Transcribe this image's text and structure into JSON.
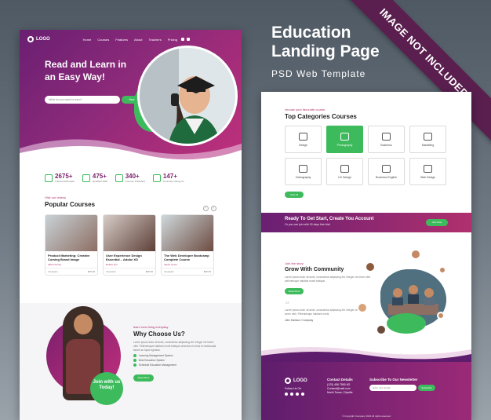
{
  "ribbon": "IMAGE NOT INCLUDED",
  "title": {
    "line1": "Education",
    "line2": "Landing Page",
    "subtitle": "PSD Web Template"
  },
  "left": {
    "logo": "LOGO",
    "nav": [
      "Home",
      "Courses",
      "Features",
      "About",
      "Teachers",
      "Pricing"
    ],
    "hero": {
      "headline": "Read and Learn in an Easy Way!",
      "search_placeholder": "What do you want to learn?",
      "search_button": "Search"
    },
    "stats": [
      {
        "num": "2675+",
        "label": "Trained Enthusiast"
      },
      {
        "num": "475+",
        "label": "Qualified Staff"
      },
      {
        "num": "340+",
        "label": "Courses Published"
      },
      {
        "num": "147+",
        "label": "Countries Listing Us"
      }
    ],
    "courses": {
      "label": "Visit our videos",
      "title": "Popular Courses",
      "items": [
        {
          "name": "Product Marketing: Creative Coming Brand Image",
          "instructor": "Albert Flores",
          "lessons": "4 lessons",
          "price": "$45.99"
        },
        {
          "name": "User Experience Design Essential – Adobe XD",
          "instructor": "Robert Fox",
          "lessons": "4 lessons",
          "price": "$45.99"
        },
        {
          "name": "The Web Developer Bootcamp Complete Course",
          "instructor": "Jacob Jones",
          "lessons": "4 lessons",
          "price": "$45.99"
        }
      ]
    },
    "why": {
      "label": "learn new thing everyday",
      "title": "Why Choose Us?",
      "body": "Lorem ipsum dolor sit amet, consectetur adipiscing elit. Integer vel lorem nibh. Pellentesque habitant morbi tristique senectus et netus et malesuada fames ac turpis egestas.",
      "features": [
        "Learning Management System",
        "Best Education System",
        "Schedule Education Management"
      ],
      "button": "Read More",
      "join": "Join with us Today!"
    }
  },
  "right": {
    "cats": {
      "label": "choose your favourite course",
      "title": "Top Categories Courses",
      "items": [
        "Design",
        "Photography",
        "Business",
        "Marketing",
        "Videography",
        "UX Design",
        "Business English",
        "Web Design"
      ],
      "active": "Photography",
      "button": "View All"
    },
    "cta": {
      "title": "Ready To Get Start, Create You Account",
      "subtitle": "Or you can join with 30 days free trial",
      "button": "Join Now"
    },
    "community": {
      "label": "Join the story",
      "title": "Grow With Community",
      "body": "Lorem ipsum dolor sit amet, consectetur adipiscing elit. Integer vel lorem nibh pellentesque habitant morbi tristique.",
      "button": "Read More"
    },
    "quote": {
      "text": "Lorem ipsum dolor sit amet, consectetur adipiscing elit. Integer vel lorem nibh. Pellentesque habitant morbi.",
      "author": "John Harrison / Company"
    },
    "footer": {
      "logo": "LOGO",
      "follow": "Follow Us On",
      "contact_title": "Contact Details",
      "contact": [
        "(123) 456 7890 6G",
        "Contact@mail.com",
        "North Tower, Cityville"
      ],
      "newsletter_title": "Subscribe To Our Newsletter",
      "newsletter_placeholder": "Enter Your Email",
      "newsletter_button": "Subscribe",
      "copyright": "© Copyright Company 2024 All rights reserved"
    }
  },
  "colors": {
    "purple": "#7a1f6e",
    "magenta": "#c0307b",
    "green": "#3dbb5c"
  }
}
